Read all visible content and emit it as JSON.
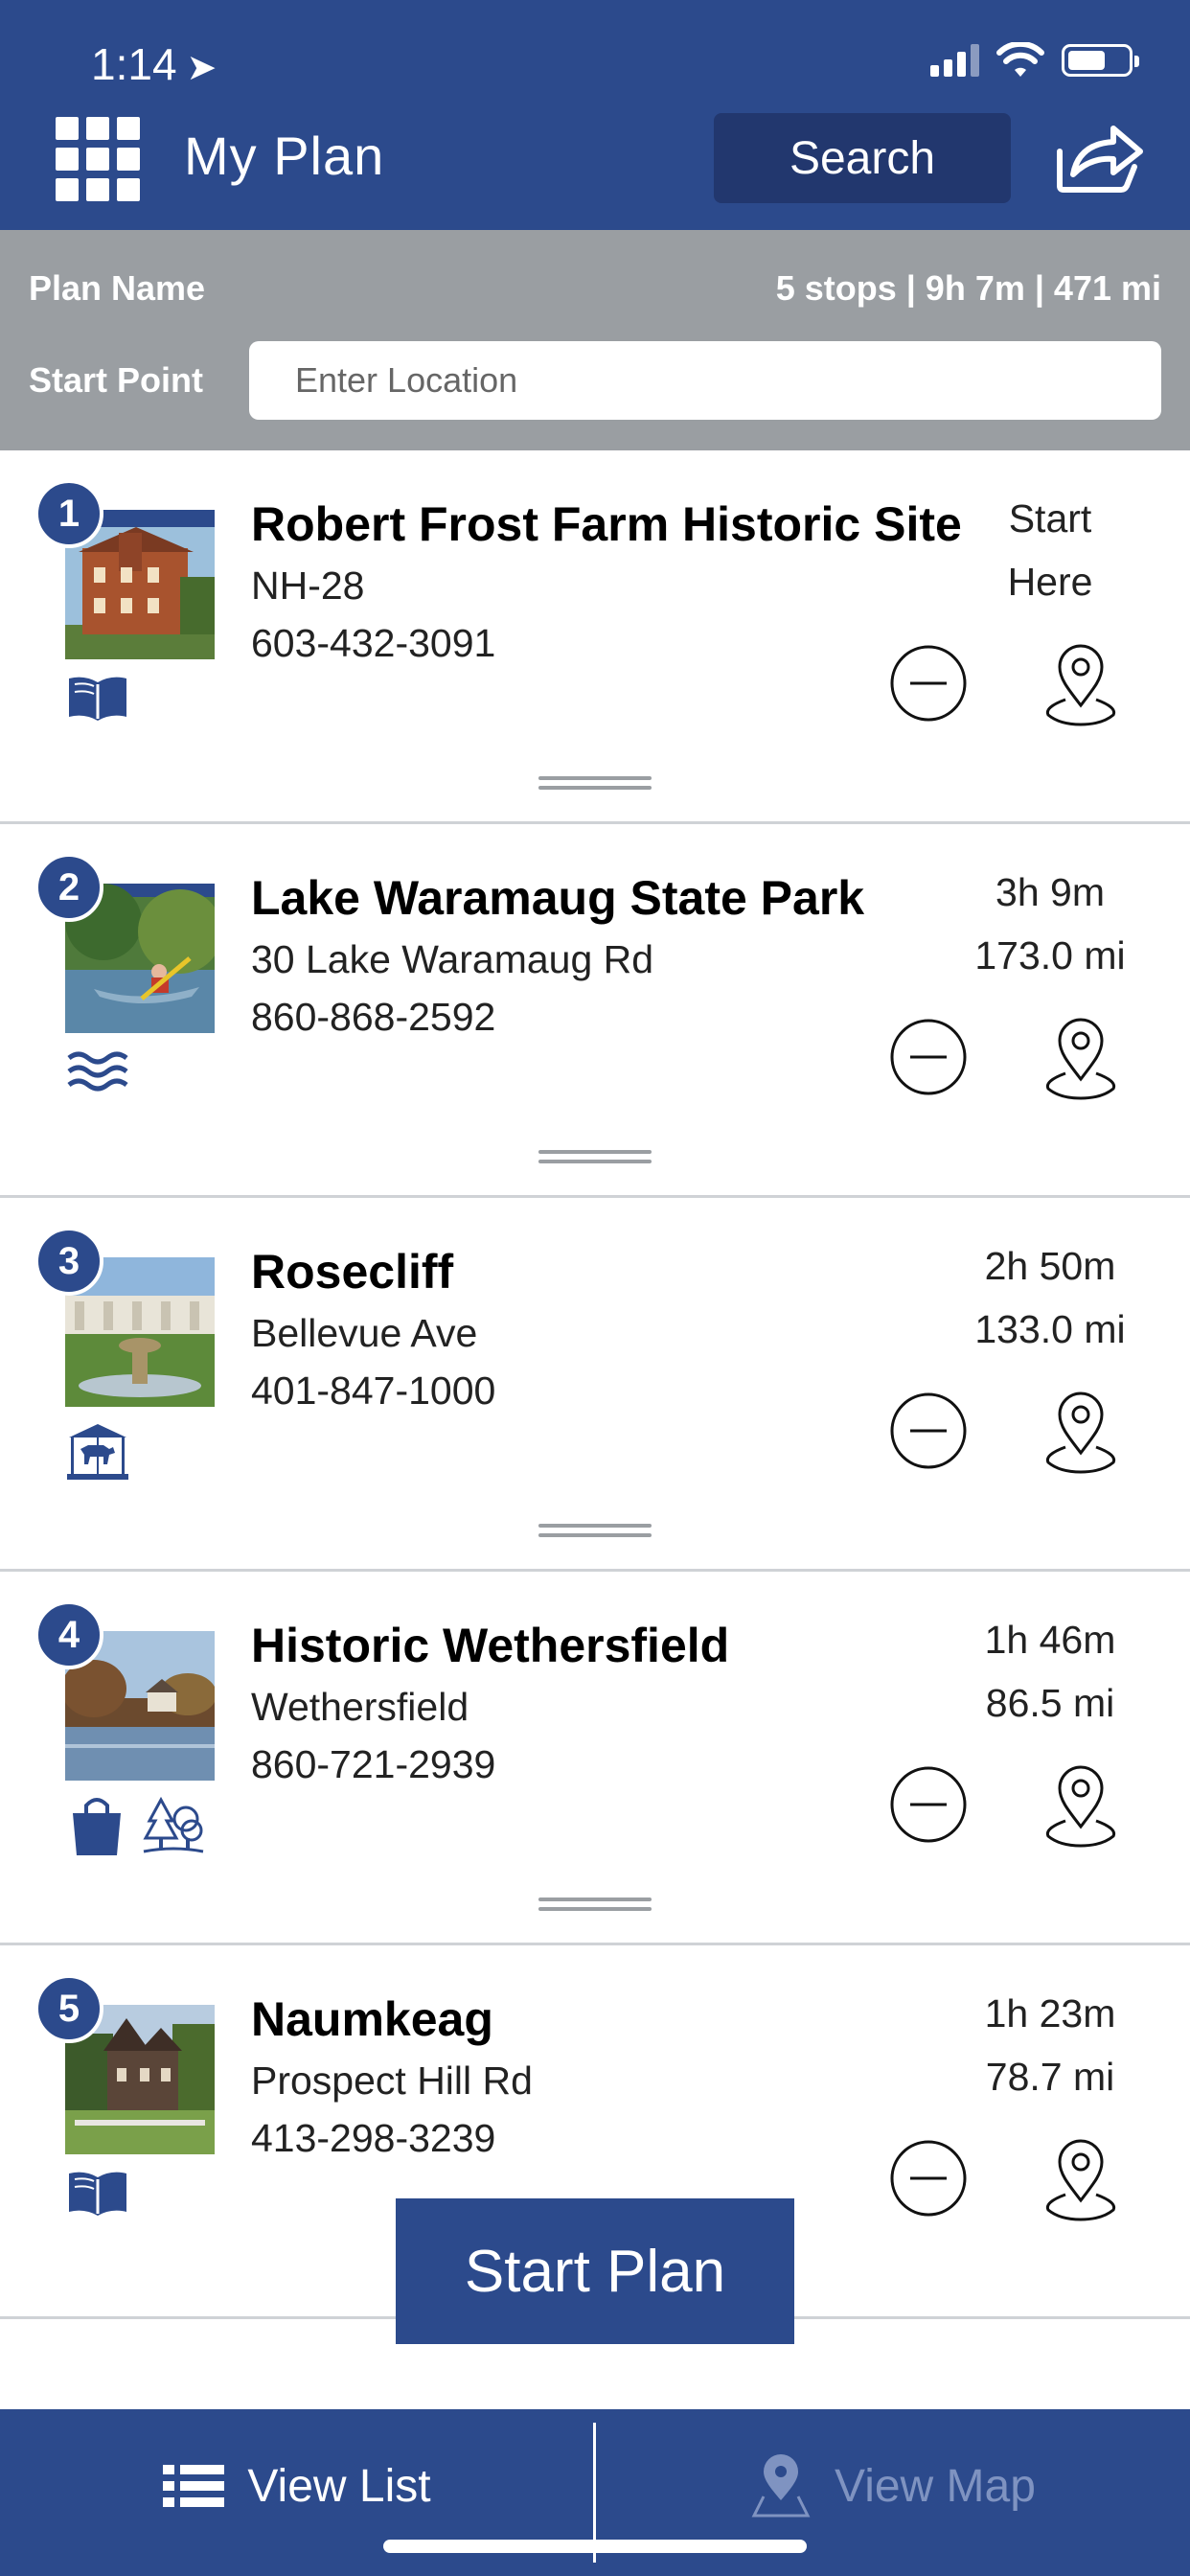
{
  "status_bar": {
    "time": "1:14"
  },
  "header": {
    "title": "My Plan",
    "search_label": "Search"
  },
  "plan": {
    "name_label": "Plan Name",
    "summary": "5 stops | 9h 7m | 471 mi",
    "start_label": "Start Point",
    "start_placeholder": "Enter Location"
  },
  "stops": [
    {
      "number": "1",
      "name": "Robert Frost Farm Historic Site",
      "address": "NH-28",
      "phone": "603-432-3091",
      "time": "Start",
      "distance": "Here",
      "category_icons": [
        "book-icon"
      ]
    },
    {
      "number": "2",
      "name": "Lake Waramaug State Park",
      "address": "30 Lake Waramaug Rd",
      "phone": "860-868-2592",
      "time": "3h 9m",
      "distance": "173.0 mi",
      "category_icons": [
        "water-icon"
      ]
    },
    {
      "number": "3",
      "name": "Rosecliff",
      "address": "Bellevue Ave",
      "phone": "401-847-1000",
      "time": "2h 50m",
      "distance": "133.0 mi",
      "category_icons": [
        "carousel-icon"
      ]
    },
    {
      "number": "4",
      "name": "Historic Wethersfield",
      "address": "Wethersfield",
      "phone": "860-721-2939",
      "time": "1h 46m",
      "distance": "86.5 mi",
      "category_icons": [
        "shopping-bag-icon",
        "trees-icon"
      ]
    },
    {
      "number": "5",
      "name": "Naumkeag",
      "address": "Prospect Hill Rd",
      "phone": "413-298-3239",
      "time": "1h 23m",
      "distance": "78.7 mi",
      "category_icons": [
        "book-icon"
      ]
    }
  ],
  "start_plan_label": "Start Plan",
  "tabs": {
    "list_label": "View List",
    "map_label": "View Map"
  },
  "colors": {
    "primary": "#2c4a8c",
    "summary_bar": "#9a9ea2",
    "inactive_tab": "#7f93c1"
  }
}
